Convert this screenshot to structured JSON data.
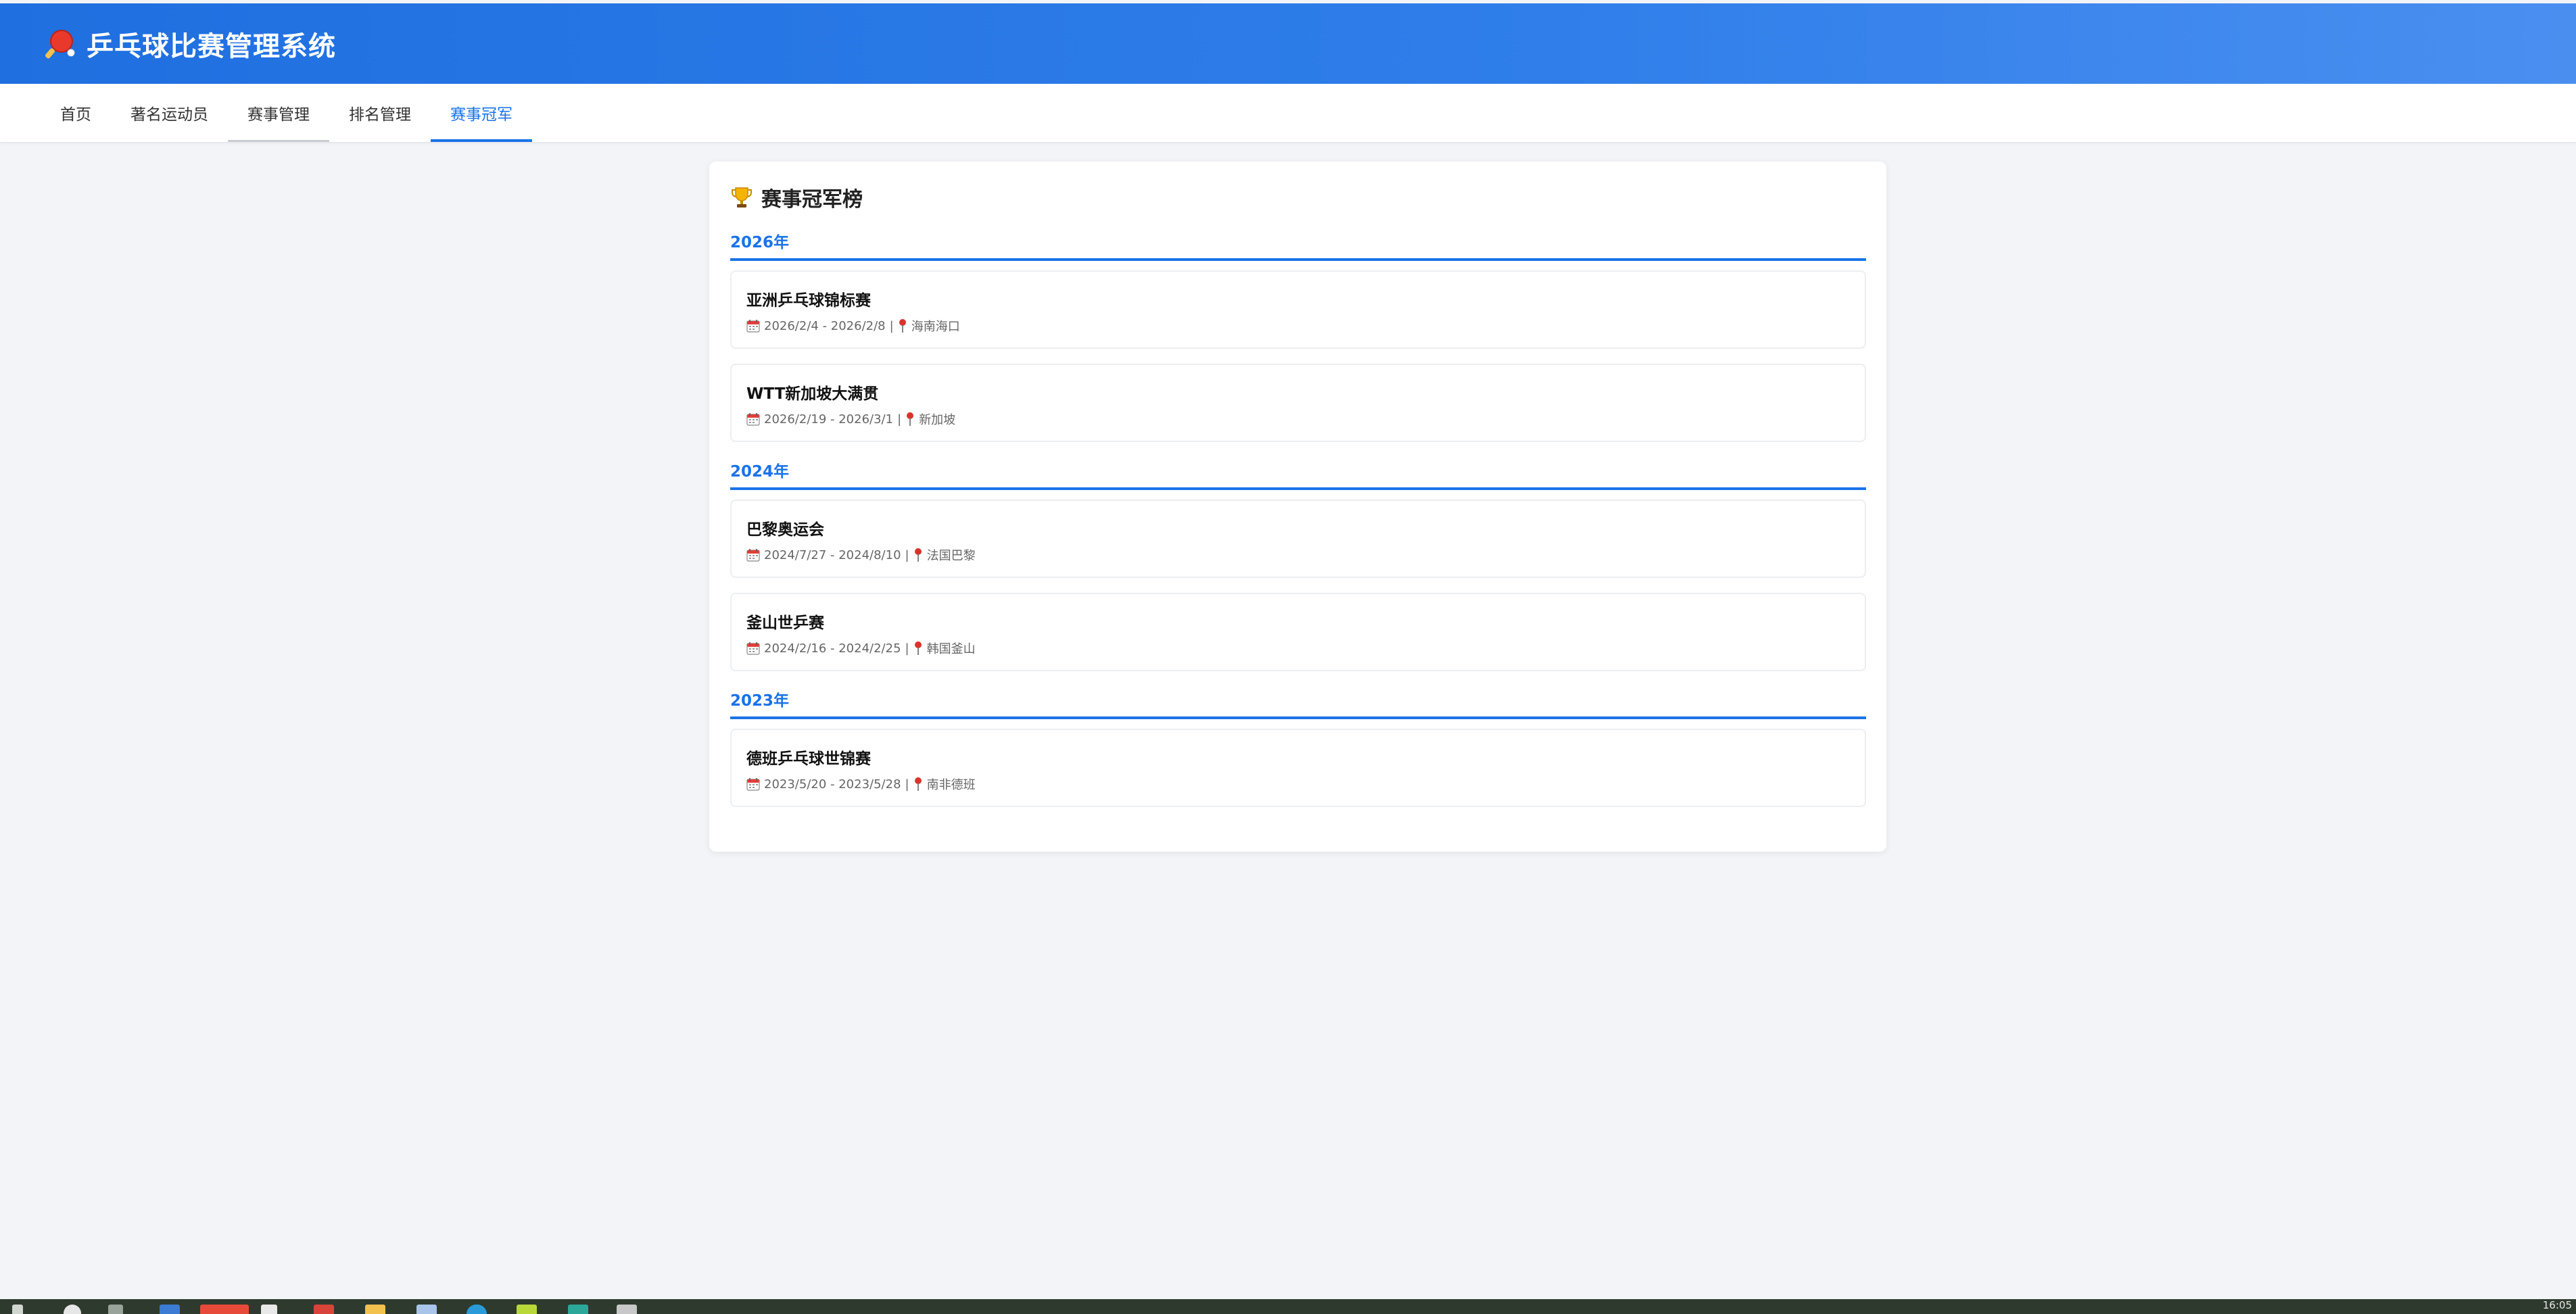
{
  "app": {
    "title": "乒乓球比赛管理系统",
    "logo_icon": "ping-pong-paddle-icon"
  },
  "nav": {
    "tabs": [
      {
        "label": "首页",
        "state": "normal"
      },
      {
        "label": "著名运动员",
        "state": "normal"
      },
      {
        "label": "赛事管理",
        "state": "hover"
      },
      {
        "label": "排名管理",
        "state": "normal"
      },
      {
        "label": "赛事冠军",
        "state": "active"
      }
    ]
  },
  "page": {
    "title": "赛事冠军榜",
    "title_icon": "trophy-icon"
  },
  "years": [
    {
      "label": "2026年",
      "events": [
        {
          "name": "亚洲乒乓球锦标赛",
          "dates": "2026/2/4 - 2026/2/8",
          "location": "海南海口"
        },
        {
          "name": "WTT新加坡大满贯",
          "dates": "2026/2/19 - 2026/3/1",
          "location": "新加坡"
        }
      ]
    },
    {
      "label": "2024年",
      "events": [
        {
          "name": "巴黎奥运会",
          "dates": "2024/7/27 - 2024/8/10",
          "location": "法国巴黎"
        },
        {
          "name": "釜山世乒赛",
          "dates": "2024/2/16 - 2024/2/25",
          "location": "韩国釜山"
        }
      ]
    },
    {
      "label": "2023年",
      "events": [
        {
          "name": "德班乒乓球世锦赛",
          "dates": "2023/5/20 - 2023/5/28",
          "location": "南非德班"
        }
      ]
    }
  ],
  "meta_separator": "|",
  "colors": {
    "header_start": "#1f6fe0",
    "header_end": "#4a8ff0",
    "accent": "#1a73e8",
    "background": "#f3f4f8",
    "taskbar": "#2e3a2e"
  },
  "taskbar": {
    "clock": "16:05"
  }
}
